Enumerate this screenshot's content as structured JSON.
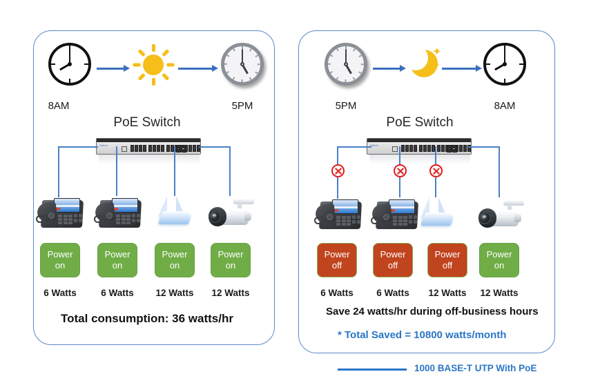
{
  "panels": {
    "day": {
      "name": "Business hours panel",
      "start_time": "8AM",
      "end_time": "5PM",
      "period_icon": "sun-icon",
      "switch_label": "PoE Switch",
      "total_text": "Total  consumption:  36 watts/hr",
      "devices": [
        {
          "icon": "ip-phone-icon",
          "power_line1": "Power",
          "power_line2": "on",
          "state": "on",
          "watts": "6 Watts"
        },
        {
          "icon": "ip-phone-icon",
          "power_line1": "Power",
          "power_line2": "on",
          "state": "on",
          "watts": "6 Watts"
        },
        {
          "icon": "access-point-icon",
          "power_line1": "Power",
          "power_line2": "on",
          "state": "on",
          "watts": "12 Watts"
        },
        {
          "icon": "cctv-camera-icon",
          "power_line1": "Power",
          "power_line2": "on",
          "state": "on",
          "watts": "12 Watts"
        }
      ]
    },
    "night": {
      "name": "Off-business hours panel",
      "start_time": "5PM",
      "end_time": "8AM",
      "period_icon": "moon-icon",
      "switch_label": "PoE Switch",
      "save_text": "Save 24 watts/hr during off-business hours",
      "saved_text": "* Total Saved = 10800 watts/month",
      "devices": [
        {
          "icon": "ip-phone-icon",
          "power_line1": "Power",
          "power_line2": "off",
          "state": "off",
          "watts": "6 Watts"
        },
        {
          "icon": "ip-phone-icon",
          "power_line1": "Power",
          "power_line2": "off",
          "state": "off",
          "watts": "6 Watts"
        },
        {
          "icon": "access-point-icon",
          "power_line1": "Power",
          "power_line2": "off",
          "state": "off",
          "watts": "12 Watts"
        },
        {
          "icon": "cctv-camera-icon",
          "power_line1": "Power",
          "power_line2": "on",
          "state": "on",
          "watts": "12 Watts"
        }
      ]
    }
  },
  "legend": {
    "label": "1000 BASE-T UTP With PoE",
    "line_color": "#2a76c6"
  },
  "colors": {
    "panel_border": "#5a87c9",
    "cable": "#4a7fc6",
    "arrow": "#3a6fbe",
    "sun_moon": "#f6be19",
    "power_on": "#70ad47",
    "power_off": "#c0441e",
    "x_mark": "#e21b1b",
    "accent_text": "#2a76c6"
  }
}
